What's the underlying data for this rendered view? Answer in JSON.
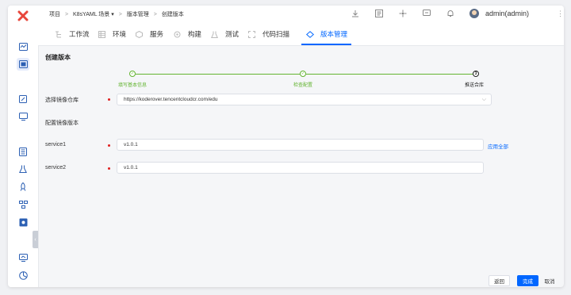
{
  "breadcrumb": {
    "items": [
      "项目",
      "K8sYAML 场景",
      "版本管理",
      "创建版本"
    ],
    "separator": ">",
    "dropdown_indicator": "▾"
  },
  "topbar": {
    "icons": [
      "download-icon",
      "document-icon",
      "integration-icon",
      "chat-icon",
      "bell-icon"
    ],
    "user_name": "admin(admin)",
    "more_glyph": "⋮"
  },
  "sidebar": {
    "icons": [
      "dashboard-icon",
      "projects-icon",
      "edit-icon",
      "monitor-icon",
      "list-icon",
      "flask-icon",
      "rocket-icon",
      "nodes-icon",
      "plugin-icon",
      "screen-icon",
      "pie-icon"
    ],
    "active_index": 1,
    "collapse_glyph": "‹"
  },
  "tabs": [
    {
      "label": "工作流",
      "icon": "workflow-icon",
      "active": false
    },
    {
      "label": "环境",
      "icon": "environment-icon",
      "active": false
    },
    {
      "label": "服务",
      "icon": "service-icon",
      "active": false
    },
    {
      "label": "构建",
      "icon": "build-icon",
      "active": false
    },
    {
      "label": "测试",
      "icon": "test-icon",
      "active": false
    },
    {
      "label": "代码扫描",
      "icon": "scan-icon",
      "active": false
    },
    {
      "label": "版本管理",
      "icon": "version-icon",
      "active": true
    }
  ],
  "page": {
    "title": "创建版本"
  },
  "steps": [
    {
      "label": "填写基本信息",
      "status": "done"
    },
    {
      "label": "检查配置",
      "status": "done"
    },
    {
      "label": "推送合库",
      "status": "current",
      "number": "3"
    }
  ],
  "step_colors": {
    "done": "#63b431",
    "current": "#222222",
    "accent": "#0066ff"
  },
  "form": {
    "registry_label": "选择镜像仓库",
    "registry_value": "https://koderover.tencentcloudcr.com/edu",
    "section_label": "配置镜像版本",
    "services": [
      {
        "name": "service1",
        "version": "v1.0.1"
      },
      {
        "name": "service2",
        "version": "v1.0.1"
      }
    ],
    "apply_all": "应用全部"
  },
  "footer": {
    "back": "返回",
    "done": "完成",
    "cancel": "取消"
  }
}
